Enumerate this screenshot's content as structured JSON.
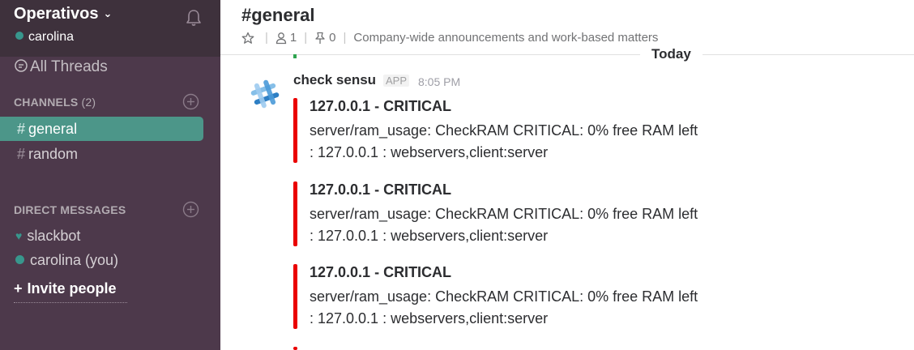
{
  "workspace": {
    "name": "Operativos",
    "user": "carolina",
    "presence_color": "#38978d"
  },
  "sidebar": {
    "all_threads": "All Threads",
    "channels_header": "CHANNELS",
    "channels_count": "(2)",
    "channels": [
      {
        "label": "general",
        "active": true
      },
      {
        "label": "random",
        "active": false
      }
    ],
    "dm_header": "DIRECT MESSAGES",
    "direct_messages": [
      {
        "label": "slackbot",
        "icon": "heart-icon"
      },
      {
        "label": "carolina (you)",
        "icon": "presence-dot-icon"
      }
    ],
    "invite_label": "Invite people",
    "invite_prefix": "+"
  },
  "channel": {
    "title": "#general",
    "members": "1",
    "pinned": "0",
    "topic": "Company-wide announcements and work-based matters"
  },
  "divider": {
    "label": "Today"
  },
  "message": {
    "author": "check sensu",
    "badge": "APP",
    "time": "8:05 PM",
    "attachments": [
      {
        "title": "127.0.0.1 - CRITICAL",
        "line1": "server/ram_usage: CheckRAM CRITICAL: 0% free RAM left",
        "line2": ": 127.0.0.1 : webservers,client:server"
      },
      {
        "title": "127.0.0.1 - CRITICAL",
        "line1": "server/ram_usage: CheckRAM CRITICAL: 0% free RAM left",
        "line2": ": 127.0.0.1 : webservers,client:server"
      },
      {
        "title": "127.0.0.1 - CRITICAL",
        "line1": "server/ram_usage: CheckRAM CRITICAL: 0% free RAM left",
        "line2": ": 127.0.0.1 : webservers,client:server"
      }
    ],
    "attachment_color": "#ea0000"
  },
  "colors": {
    "sidebar_bg": "#4d394b",
    "sidebar_header_bg": "#3e313c",
    "active_channel_bg": "#4c9689"
  }
}
